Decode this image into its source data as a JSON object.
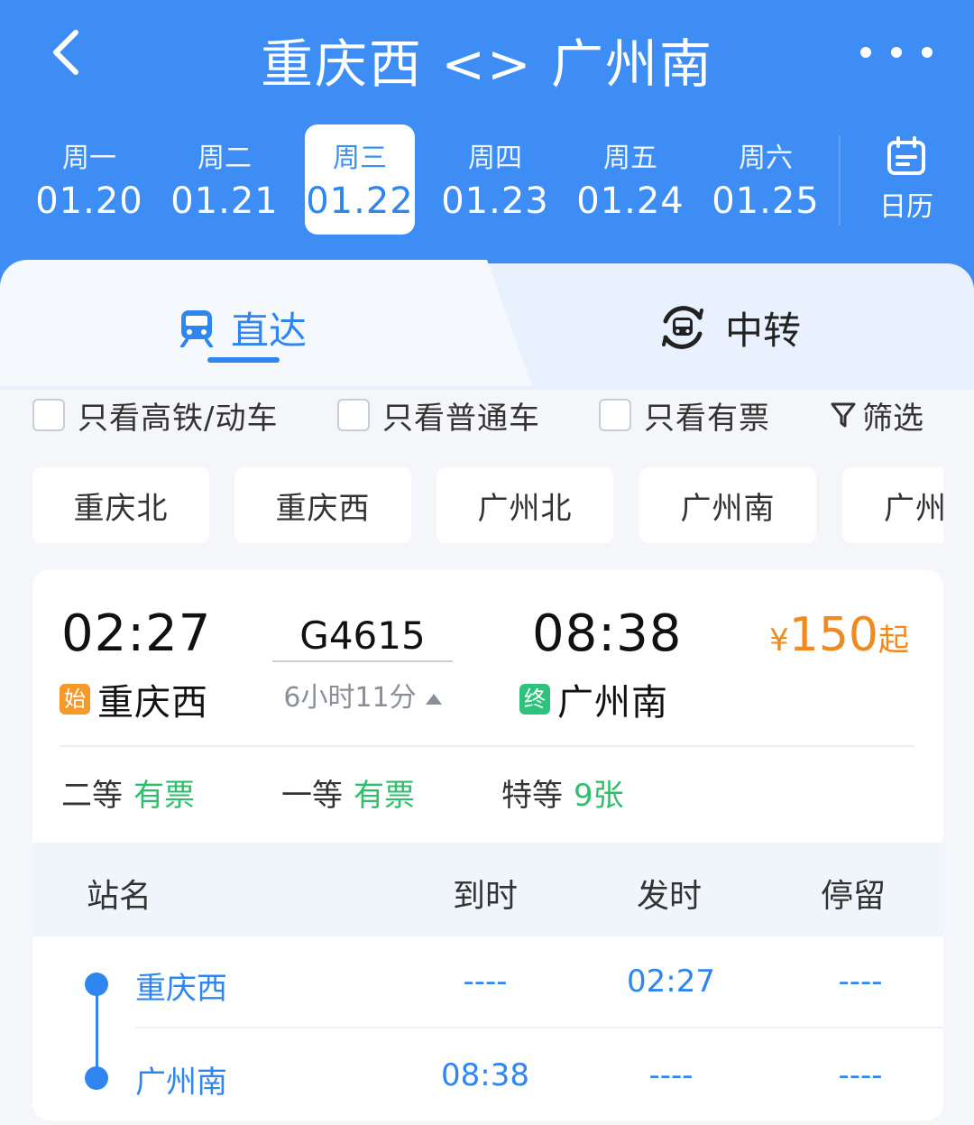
{
  "header": {
    "title": "重庆西 <> 广州南",
    "calendar_label": "日历"
  },
  "dates": [
    {
      "weekday": "周一",
      "date": "01.20"
    },
    {
      "weekday": "周二",
      "date": "01.21"
    },
    {
      "weekday": "周三",
      "date": "01.22",
      "selected": true
    },
    {
      "weekday": "周四",
      "date": "01.23"
    },
    {
      "weekday": "周五",
      "date": "01.24"
    },
    {
      "weekday": "周六",
      "date": "01.25"
    }
  ],
  "tabs": {
    "direct": "直达",
    "transfer": "中转"
  },
  "filters": {
    "high_speed_only": "只看高铁/动车",
    "normal_only": "只看普通车",
    "available_only": "只看有票",
    "screen": "筛选"
  },
  "station_chips": [
    "重庆北",
    "重庆西",
    "广州北",
    "广州南",
    "广州"
  ],
  "train": {
    "departure_time": "02:27",
    "arrival_time": "08:38",
    "number": "G4615",
    "duration": "6小时11分",
    "price_symbol": "¥",
    "price": "150",
    "price_suffix": "起",
    "start_tag": "始",
    "end_tag": "终",
    "from_station": "重庆西",
    "to_station": "广州南",
    "seats": [
      {
        "class": "二等",
        "availability": "有票"
      },
      {
        "class": "一等",
        "availability": "有票"
      },
      {
        "class": "特等",
        "availability": "9张"
      }
    ],
    "stop_table": {
      "headers": {
        "station": "站名",
        "arrive": "到时",
        "depart": "发时",
        "stay": "停留"
      },
      "rows": [
        {
          "station": "重庆西",
          "arrive": "----",
          "depart": "02:27",
          "stay": "----"
        },
        {
          "station": "广州南",
          "arrive": "08:38",
          "depart": "----",
          "stay": "----"
        }
      ]
    }
  },
  "colors": {
    "header_bg": "#3d8df5",
    "accent": "#2f86f0",
    "price": "#f08a1d",
    "available": "#2fbf6b"
  }
}
